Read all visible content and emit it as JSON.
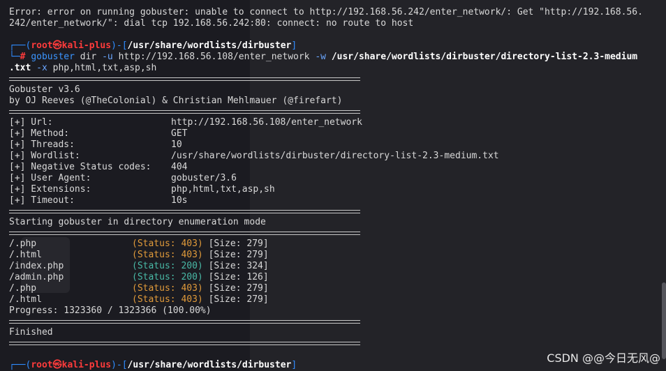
{
  "error": {
    "line1": "Error: error on running gobuster: unable to connect to http://192.168.56.242/enter_network/: Get \"http://192.168.56.",
    "line2": "242/enter_network/\": dial tcp 192.168.56.242:80: connect: no route to host"
  },
  "prompt": {
    "prefix": "┌──(",
    "user": "root㉿kali-plus",
    "mid": ")-[",
    "path": "/usr/share/wordlists/dirbuster",
    "close": "]",
    "hash_prefix": "└─",
    "hash": "#"
  },
  "command": {
    "name": "gobuster",
    "args1": "dir",
    "flag_u": "-u",
    "url": "http://192.168.56.108/enter_network",
    "flag_w": "-w",
    "wordlist_a": "/usr/share/wordlists/dirbuster/directory-list-2.3-medium",
    "wordlist_b": ".txt",
    "flag_x": "-x",
    "ext": "php,html,txt,asp,sh"
  },
  "banner": {
    "title": "Gobuster v3.6",
    "author": "by OJ Reeves (@TheColonial) & Christian Mehlmauer (@firefart)"
  },
  "config": [
    {
      "key": "[+] Url:",
      "value": "http://192.168.56.108/enter_network"
    },
    {
      "key": "[+] Method:",
      "value": "GET"
    },
    {
      "key": "[+] Threads:",
      "value": "10"
    },
    {
      "key": "[+] Wordlist:",
      "value": "/usr/share/wordlists/dirbuster/directory-list-2.3-medium.txt"
    },
    {
      "key": "[+] Negative Status codes:",
      "value": "404"
    },
    {
      "key": "[+] User Agent:",
      "value": "gobuster/3.6"
    },
    {
      "key": "[+] Extensions:",
      "value": "php,html,txt,asp,sh"
    },
    {
      "key": "[+] Timeout:",
      "value": "10s"
    }
  ],
  "starting": "Starting gobuster in directory enumeration mode",
  "results": [
    {
      "path": "/.php",
      "status": "(Status: 403)",
      "size": "[Size: 279]"
    },
    {
      "path": "/.html",
      "status": "(Status: 403)",
      "size": "[Size: 279]"
    },
    {
      "path": "/index.php",
      "status": "(Status: 200)",
      "size": "[Size: 324]"
    },
    {
      "path": "/admin.php",
      "status": "(Status: 200)",
      "size": "[Size: 126]"
    },
    {
      "path": "/.php",
      "status": "(Status: 403)",
      "size": "[Size: 279]"
    },
    {
      "path": "/.html",
      "status": "(Status: 403)",
      "size": "[Size: 279]"
    }
  ],
  "progress": "Progress: 1323360 / 1323366 (100.00%)",
  "finished": "Finished",
  "watermark": "CSDN @@今日无风@",
  "colors": {
    "status_403": "#e09a3a",
    "status_200": "#49b9a6",
    "prompt_blue": "#2f8cff",
    "prompt_red": "#ff3b3b"
  }
}
